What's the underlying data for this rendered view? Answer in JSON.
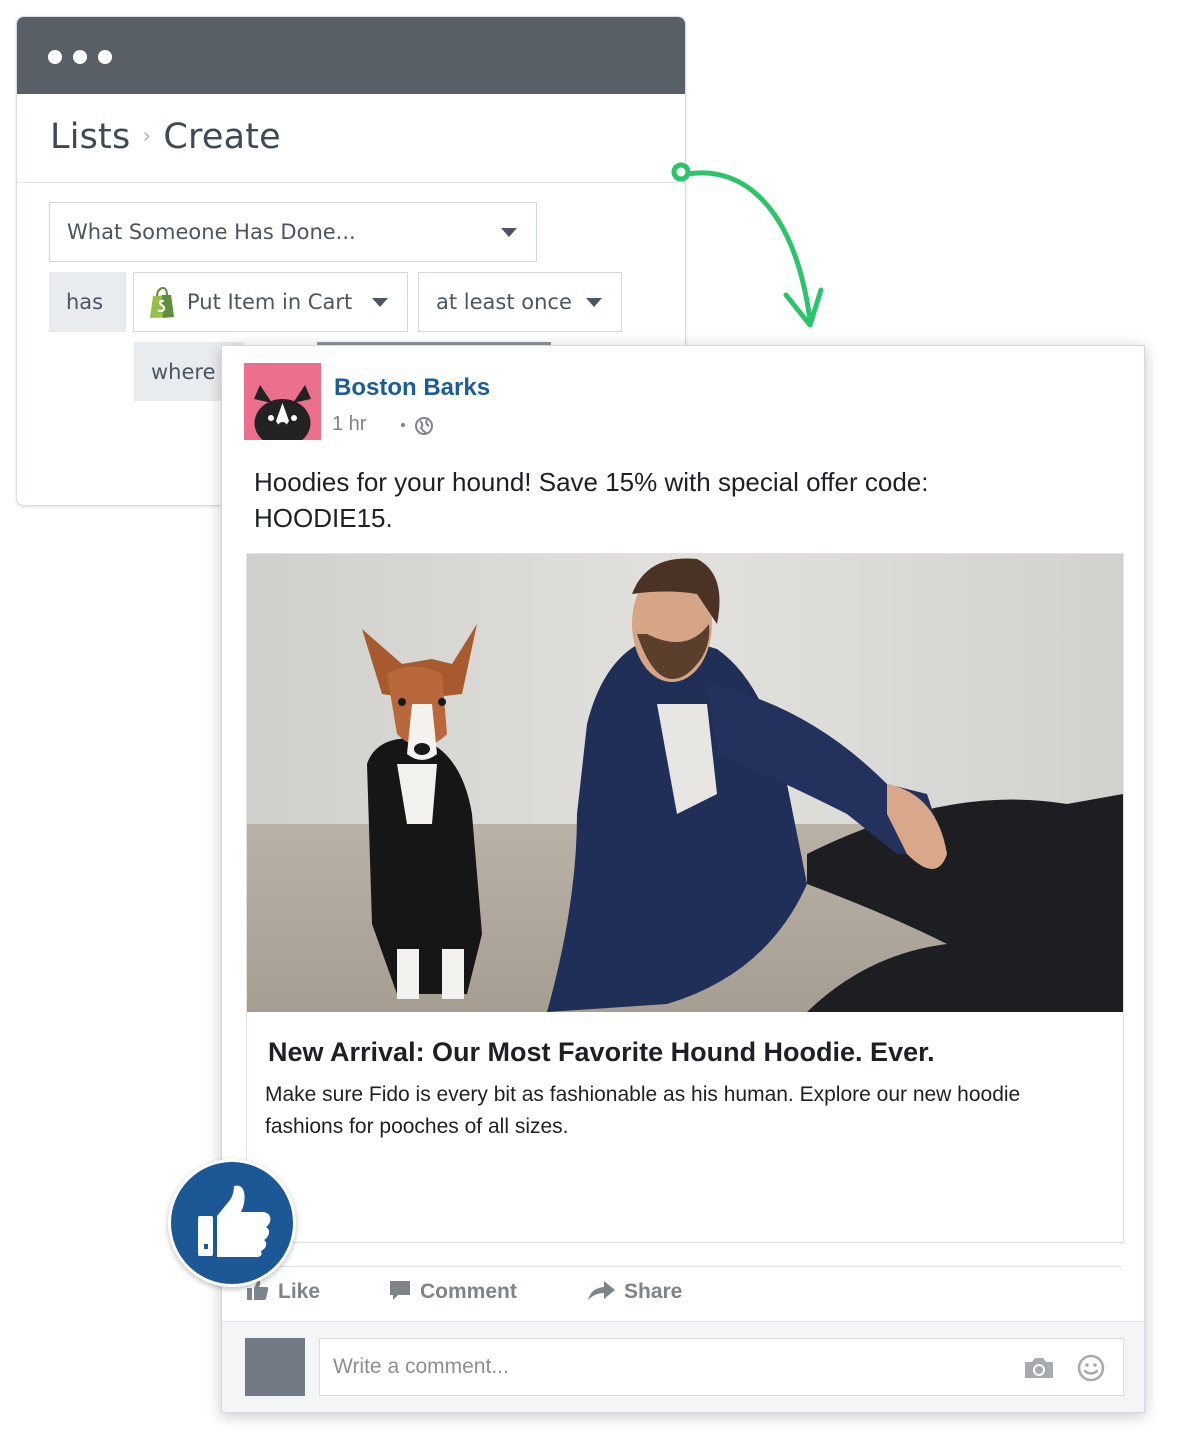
{
  "builder": {
    "breadcrumb": {
      "root": "Lists",
      "current": "Create"
    },
    "condition_select": "What Someone Has Done...",
    "verb": "has",
    "event_select": "Put Item in Cart",
    "frequency_select": "at least once",
    "filter_label": "where"
  },
  "post": {
    "page_name": "Boston Barks",
    "time": "1 hr",
    "message": "Hoodies for your hound!  Save 15% with special offer code: HOODIE15.",
    "link_title": "New Arrival:  Our Most Favorite Hound Hoodie. Ever.",
    "link_description": "Make sure Fido is every bit as fashionable as his human.  Explore our new hoodie fashions for pooches of all sizes.",
    "actions": {
      "like": "Like",
      "comment": "Comment",
      "share": "Share"
    },
    "comment_placeholder": "Write a comment..."
  },
  "colors": {
    "titlebar": "#585f66",
    "accent_green": "#2bc46b",
    "page_name_blue": "#1b5e97",
    "like_badge_blue": "#1c5796",
    "avatar_pink": "#ec6f8c"
  },
  "icons": [
    "shopify-bag-icon",
    "caret-down-icon",
    "globe-icon",
    "like-icon",
    "comment-icon",
    "share-icon",
    "camera-icon",
    "smiley-icon",
    "thumbs-up-icon"
  ]
}
